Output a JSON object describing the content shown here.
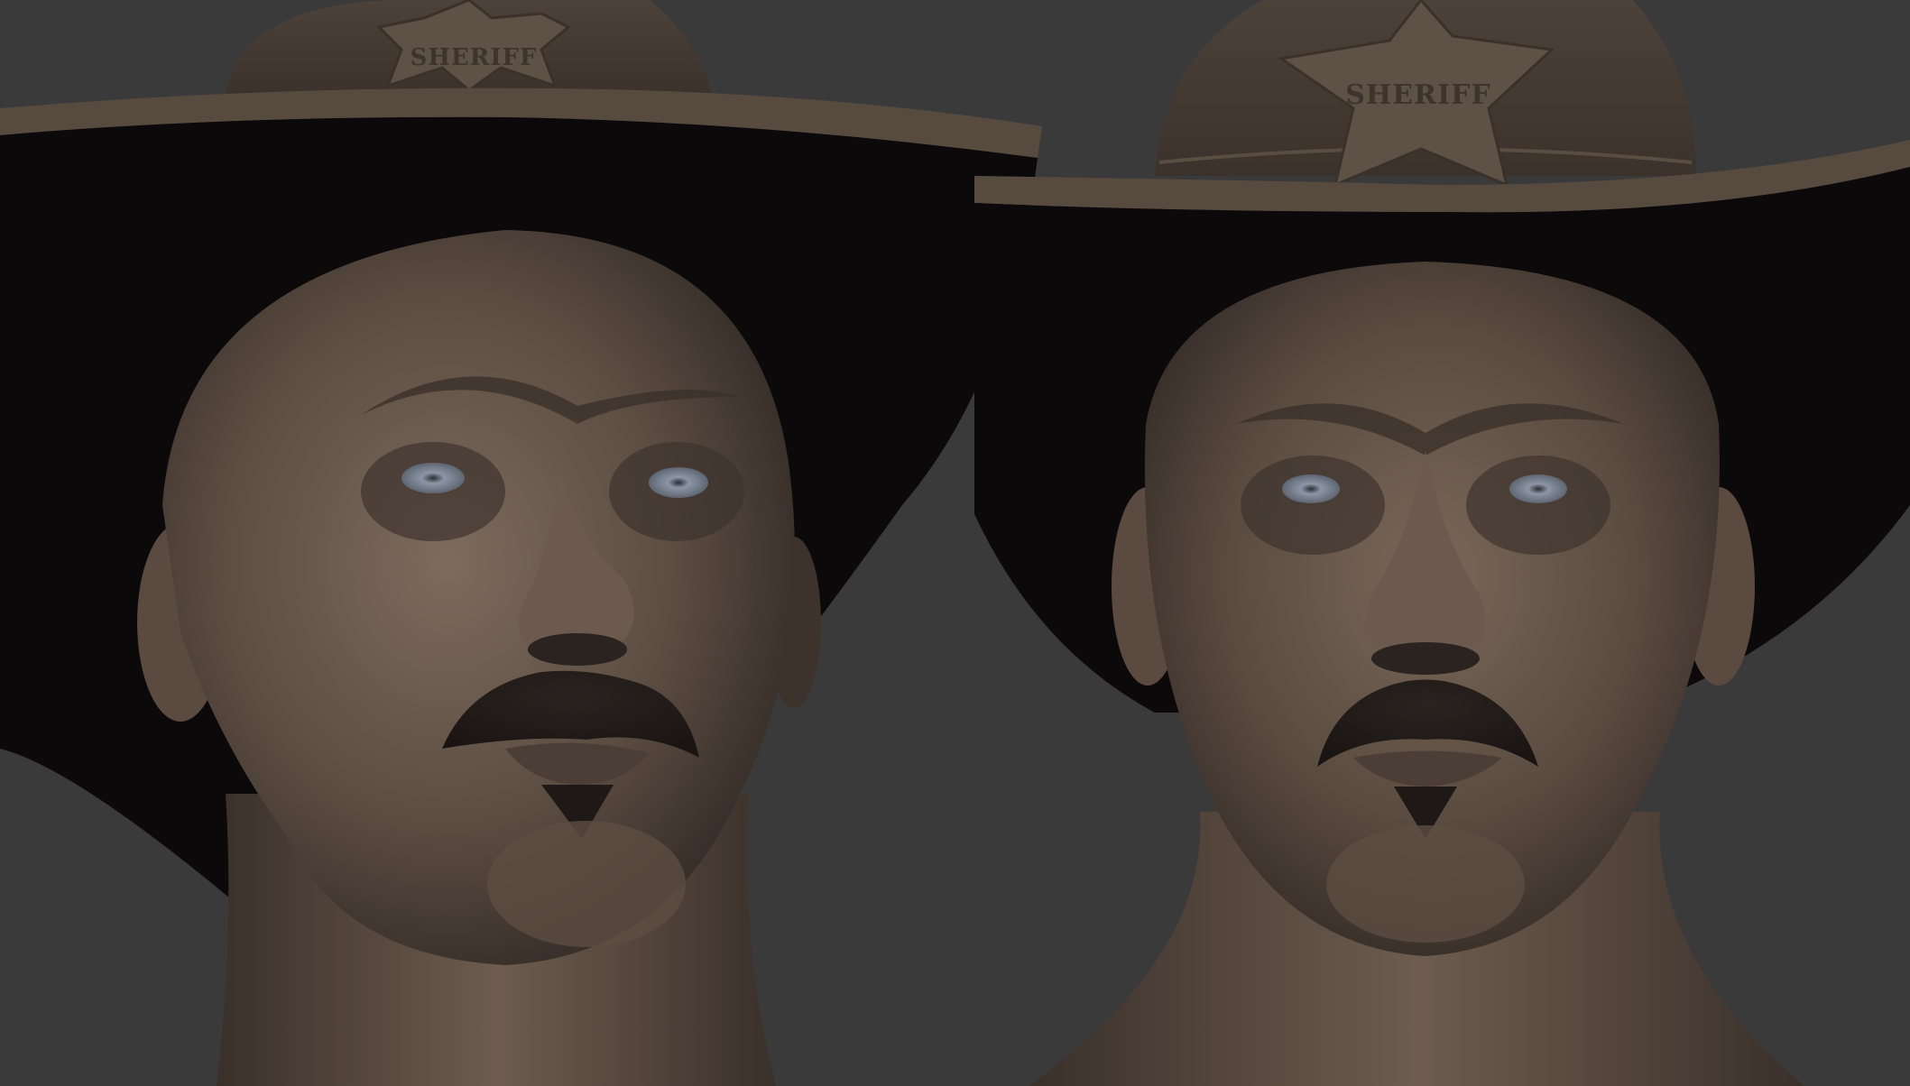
{
  "colors": {
    "background": "#3a3a3a",
    "hat_brim_underside": "#0b0909",
    "hat_crown": "#4a3f36",
    "hat_band_edge": "#5a4d42",
    "skin_light": "#7c6a5c",
    "skin_mid": "#5e4f43",
    "skin_dark": "#2a2320",
    "mustache": "#231d1a",
    "eye_iris": "#8c96a6",
    "badge": "#5e5146"
  },
  "left_view": {
    "badge_text": "SHERIFF",
    "angle": "three-quarter-low"
  },
  "right_view": {
    "badge_text": "SHERIFF",
    "angle": "front"
  }
}
